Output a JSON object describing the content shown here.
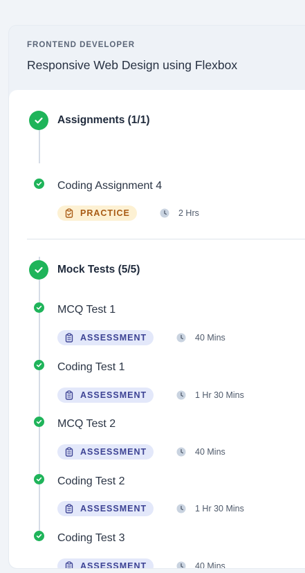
{
  "header": {
    "subtitle": "FRONTEND DEVELOPER",
    "title": "Responsive Web Design using Flexbox"
  },
  "sections": [
    {
      "title": "Assignments (1/1)",
      "status": "completed",
      "items": [
        {
          "title": "Coding Assignment 4",
          "badge": "PRACTICE",
          "badge_type": "practice",
          "duration": "2 Hrs",
          "status": "completed"
        }
      ]
    },
    {
      "title": "Mock Tests (5/5)",
      "status": "completed",
      "items": [
        {
          "title": "MCQ Test 1",
          "badge": "ASSESSMENT",
          "badge_type": "assessment",
          "duration": "40 Mins",
          "status": "completed"
        },
        {
          "title": "Coding Test 1",
          "badge": "ASSESSMENT",
          "badge_type": "assessment",
          "duration": "1 Hr 30 Mins",
          "status": "completed"
        },
        {
          "title": "MCQ Test 2",
          "badge": "ASSESSMENT",
          "badge_type": "assessment",
          "duration": "40 Mins",
          "status": "completed"
        },
        {
          "title": "Coding Test 2",
          "badge": "ASSESSMENT",
          "badge_type": "assessment",
          "duration": "1 Hr 30 Mins",
          "status": "completed"
        },
        {
          "title": "Coding Test 3",
          "badge": "ASSESSMENT",
          "badge_type": "assessment",
          "duration": "40 Mins",
          "status": "completed"
        }
      ]
    }
  ],
  "icons": {
    "completed": "check-circle-icon",
    "badge": "clipboard-icon",
    "duration": "clock-icon"
  },
  "colors": {
    "success": "#1fb45a",
    "practice_bg": "#fdf1d3",
    "practice_text": "#a85b14",
    "assessment_bg": "#e3e8fa",
    "assessment_text": "#3d4394"
  }
}
